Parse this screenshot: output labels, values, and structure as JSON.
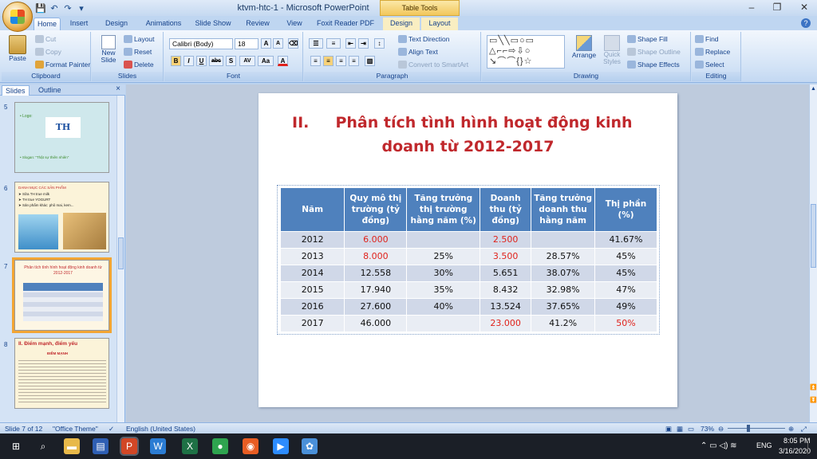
{
  "window": {
    "title": "ktvm-htc-1 - Microsoft PowerPoint",
    "context_tab": "Table Tools"
  },
  "tabs": [
    "Home",
    "Insert",
    "Design",
    "Animations",
    "Slide Show",
    "Review",
    "View",
    "Foxit Reader PDF",
    "Design",
    "Layout"
  ],
  "ribbon": {
    "clipboard": {
      "paste": "Paste",
      "cut": "Cut",
      "copy": "Copy",
      "format_painter": "Format Painter",
      "label": "Clipboard"
    },
    "slides": {
      "new_slide": "New Slide",
      "layout": "Layout",
      "reset": "Reset",
      "delete": "Delete",
      "label": "Slides"
    },
    "font": {
      "name": "Calibri (Body)",
      "size": "18",
      "bold": "B",
      "italic": "I",
      "underline": "U",
      "strike": "abc",
      "shadow": "S",
      "spacing": "AV",
      "case": "Aa",
      "color": "A",
      "grow": "A",
      "shrink": "A",
      "label": "Font"
    },
    "paragraph": {
      "text_direction": "Text Direction",
      "align_text": "Align Text",
      "convert": "Convert to SmartArt",
      "label": "Paragraph"
    },
    "drawing": {
      "arrange": "Arrange",
      "quick_styles": "Quick Styles",
      "shape_fill": "Shape Fill",
      "shape_outline": "Shape Outline",
      "shape_effects": "Shape Effects",
      "label": "Drawing"
    },
    "editing": {
      "find": "Find",
      "replace": "Replace",
      "select": "Select",
      "label": "Editing"
    }
  },
  "panel": {
    "tab_slides": "Slides",
    "tab_outline": "Outline"
  },
  "thumbnails": [
    {
      "num": "5",
      "lines": [
        "• Logo:",
        "TH",
        "• Slogan: \"Thật sự thiên nhiên\""
      ]
    },
    {
      "num": "6",
      "lines": [
        "DANH MỤC CÁC SẢN PHẨM",
        "➤ Sữa TH true milk",
        "➤ TH true YOGURT",
        "➤ Sản phẩm khác: phô mai, kem..."
      ]
    },
    {
      "num": "7",
      "lines": [
        "Phân tích tình hình hoạt động kinh doanh từ 2012-2017"
      ]
    },
    {
      "num": "8",
      "lines": [
        "II. Điểm mạnh, điểm yếu",
        "ĐIỂM MẠNH"
      ]
    }
  ],
  "slide": {
    "title_num": "II.",
    "title_line1": "Phân tích tình hình hoạt động kinh",
    "title_line2": "doanh  từ 2012-2017",
    "headers": [
      "Năm",
      "Quy mô thị trường (tỷ đồng)",
      "Tăng trưởng thị trường hằng năm (%)",
      "Doanh thu (tỷ đồng)",
      "Tăng trưởng doanh thu hằng năm",
      "Thị phần (%)"
    ],
    "rows": [
      [
        "2012",
        "6.000",
        "",
        "2.500",
        "",
        "41.67%"
      ],
      [
        "2013",
        "8.000",
        "25%",
        "3.500",
        "28.57%",
        "45%"
      ],
      [
        "2014",
        "12.558",
        "30%",
        "5.651",
        "38.07%",
        "45%"
      ],
      [
        "2015",
        "17.940",
        "35%",
        "8.432",
        "32.98%",
        "47%"
      ],
      [
        "2016",
        "27.600",
        "40%",
        "13.524",
        "37.65%",
        "49%"
      ],
      [
        "2017",
        "46.000",
        "",
        "23.000",
        "41.2%",
        "50%"
      ]
    ],
    "red_cells": [
      [
        0,
        1
      ],
      [
        0,
        3
      ],
      [
        1,
        1
      ],
      [
        1,
        3
      ],
      [
        5,
        3
      ],
      [
        5,
        5
      ]
    ]
  },
  "status": {
    "slide": "Slide 7 of 12",
    "theme": "\"Office Theme\"",
    "language": "English (United States)",
    "zoom": "73%"
  },
  "tray": {
    "lang": "ENG",
    "time": "8:05 PM",
    "date": "3/16/2020"
  },
  "colors": {
    "title_red": "#c0282c",
    "header_blue": "#4f81bd",
    "value_red": "#e0221b"
  }
}
